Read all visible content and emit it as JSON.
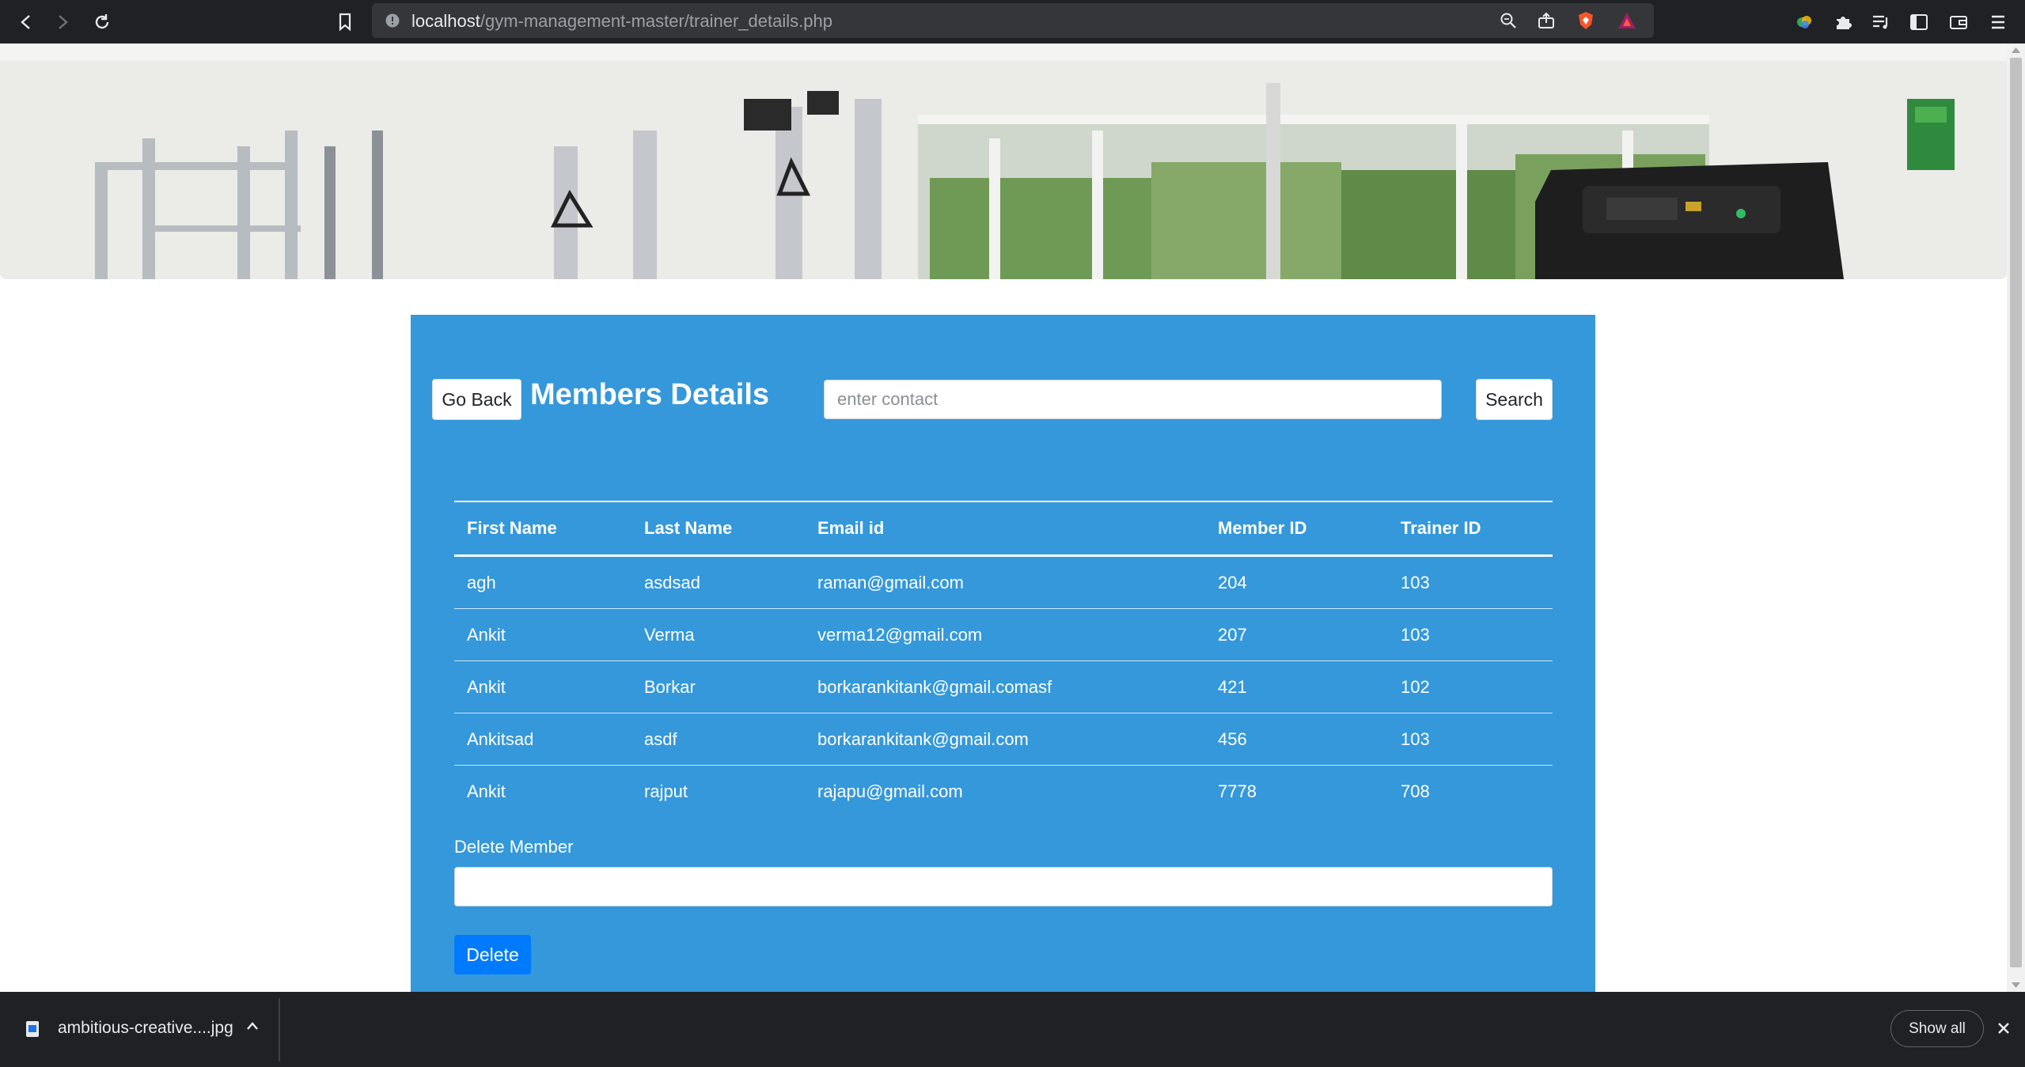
{
  "browser": {
    "url_host": "localhost",
    "url_path": "/gym-management-master/trainer_details.php"
  },
  "page": {
    "back_button": "Go Back",
    "title": "Members Details",
    "search_placeholder": "enter contact",
    "search_button": "Search",
    "table": {
      "headers": [
        "First Name",
        "Last Name",
        "Email id",
        "Member ID",
        "Trainer ID"
      ],
      "rows": [
        [
          "agh",
          "asdsad",
          "raman@gmail.com",
          "204",
          "103"
        ],
        [
          "Ankit",
          "Verma",
          "verma12@gmail.com",
          "207",
          "103"
        ],
        [
          "Ankit",
          "Borkar",
          "borkarankitank@gmail.comasf",
          "421",
          "102"
        ],
        [
          "Ankitsad",
          "asdf",
          "borkarankitank@gmail.com",
          "456",
          "103"
        ],
        [
          "Ankit",
          "rajput",
          "rajapu@gmail.com",
          "7778",
          "708"
        ]
      ]
    },
    "delete_label": "Delete Member",
    "delete_button": "Delete"
  },
  "downloads": {
    "file_name": "ambitious-creative....jpg",
    "show_all": "Show all"
  },
  "colors": {
    "panel": "#3498db",
    "delete_button": "#007bff",
    "chrome": "#202124"
  }
}
